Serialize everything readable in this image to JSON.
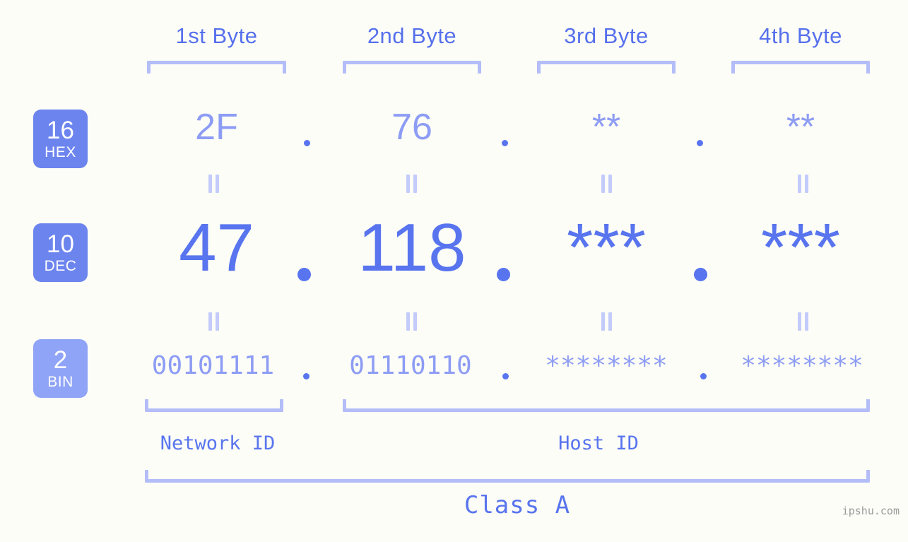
{
  "background_color": "#fcfdf7",
  "accent_color": "#5874ee",
  "accent_light_color": "#8d9cf4",
  "bracket_color": "#b3bdf8",
  "badge_color": "#6c84ee",
  "badge_color_light": "#90a4f7",
  "header": {
    "bytes": [
      {
        "label": "1st Byte"
      },
      {
        "label": "2nd Byte"
      },
      {
        "label": "3rd Byte"
      },
      {
        "label": "4th Byte"
      }
    ]
  },
  "rows": [
    {
      "base": "16",
      "base_name": "HEX",
      "values": [
        "2F",
        "76",
        "**",
        "**"
      ],
      "separators": [
        ".",
        ".",
        "."
      ]
    },
    {
      "base": "10",
      "base_name": "DEC",
      "values": [
        "47",
        "118",
        "***",
        "***"
      ],
      "separators": [
        ".",
        ".",
        "."
      ]
    },
    {
      "base": "2",
      "base_name": "BIN",
      "values": [
        "00101111",
        "01110110",
        "********",
        "********"
      ],
      "separators": [
        ".",
        ".",
        "."
      ]
    }
  ],
  "equals_symbol": "=",
  "footer": {
    "network_id_label": "Network ID",
    "host_id_label": "Host ID",
    "class_label": "Class A"
  },
  "watermark": "ipshu.com"
}
